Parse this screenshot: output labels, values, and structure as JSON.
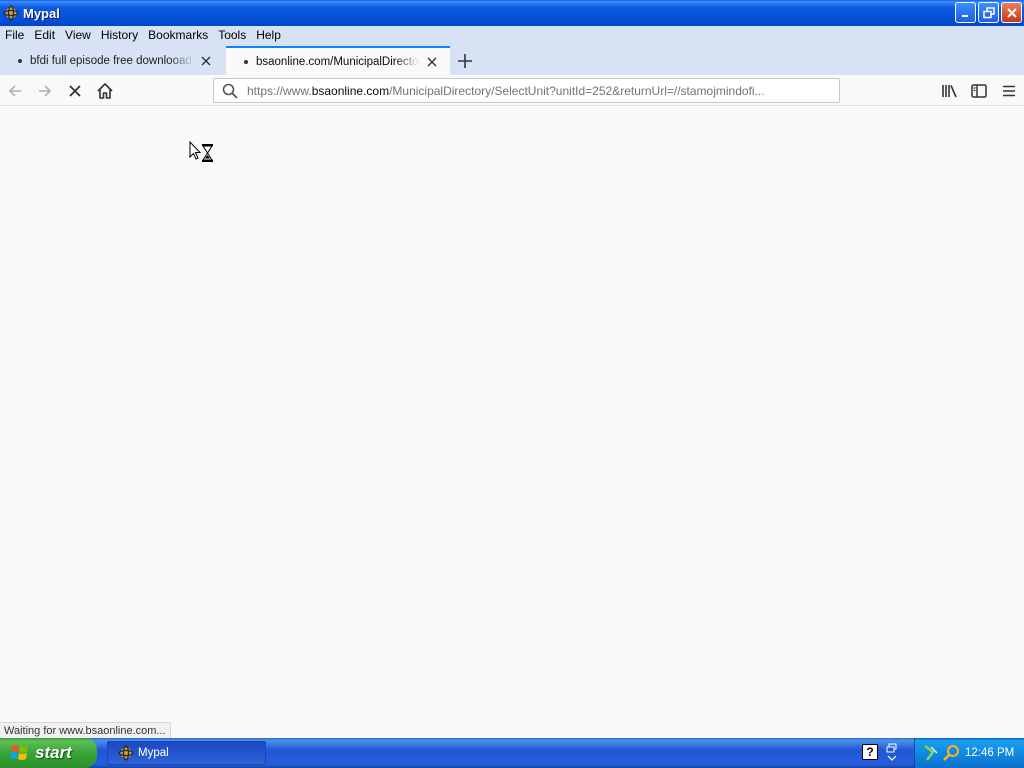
{
  "window": {
    "title": "Mypal"
  },
  "menu": [
    "File",
    "Edit",
    "View",
    "History",
    "Bookmarks",
    "Tools",
    "Help"
  ],
  "tabs": [
    {
      "title": "bfdi full episode free downlooad pu",
      "active": false
    },
    {
      "title": "bsaonline.com/MunicipalDirectory/",
      "active": true
    }
  ],
  "urlbar": {
    "scheme": "https://www.",
    "host": "bsaonline.com",
    "path": "/MunicipalDirectory/SelectUnit?unitId=252&returnUrl=//stamojmindofi..."
  },
  "status": {
    "text": "Waiting for www.bsaonline.com..."
  },
  "taskbar": {
    "start_label": "start",
    "task_label": "Mypal",
    "help_glyph": "?",
    "clock": "12:46 PM"
  },
  "colors": {
    "accent": "#0a84ff",
    "titlebar": "#0a5ae0",
    "taskbar": "#245edb",
    "start": "#37a537"
  }
}
